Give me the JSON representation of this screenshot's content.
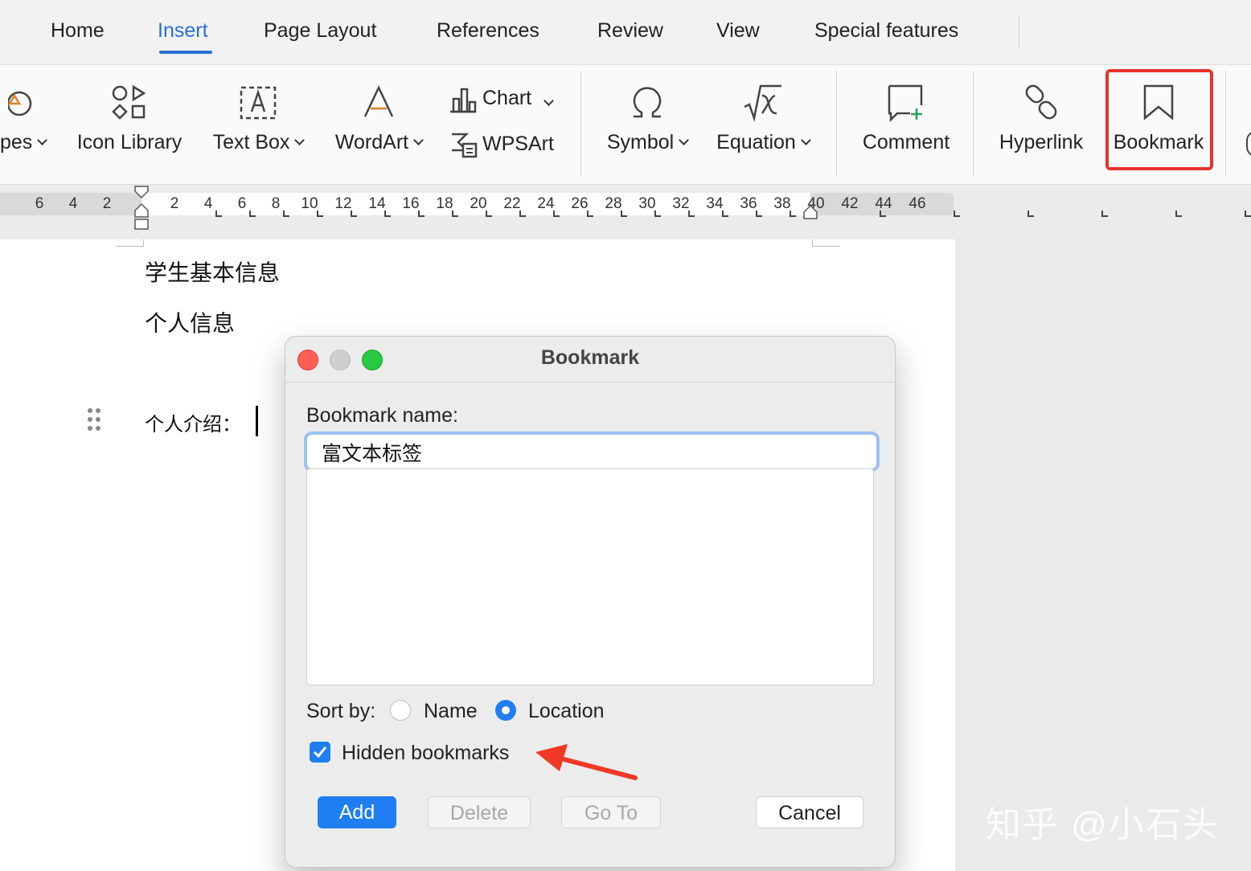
{
  "menu_tabs": [
    {
      "label": "Home"
    },
    {
      "label": "Insert"
    },
    {
      "label": "Page Layout"
    },
    {
      "label": "References"
    },
    {
      "label": "Review"
    },
    {
      "label": "View"
    },
    {
      "label": "Special features"
    }
  ],
  "active_tab": "Insert",
  "ribbon": {
    "shapes": "pes",
    "icon_library": "Icon Library",
    "text_box": "Text Box",
    "wordart": "WordArt",
    "chart": "Chart",
    "wpsart": "WPSArt",
    "symbol": "Symbol",
    "equation": "Equation",
    "comment": "Comment",
    "hyperlink": "Hyperlink",
    "bookmark": "Bookmark"
  },
  "ruler": {
    "numbers": [
      "6",
      "4",
      "2",
      "2",
      "4",
      "6",
      "8",
      "10",
      "12",
      "14",
      "16",
      "18",
      "20",
      "22",
      "24",
      "26",
      "28",
      "30",
      "32",
      "34",
      "36",
      "38",
      "40",
      "42",
      "44",
      "46"
    ]
  },
  "document": {
    "line1": "学生基本信息",
    "line2": "个人信息",
    "line3": "个人介绍："
  },
  "dialog": {
    "title": "Bookmark",
    "name_label": "Bookmark name:",
    "name_value": "富文本标签",
    "sort_label": "Sort by:",
    "sort_name": "Name",
    "sort_location": "Location",
    "sort_selected": "Location",
    "hidden_label": "Hidden bookmarks",
    "hidden_checked": true,
    "add": "Add",
    "delete": "Delete",
    "goto": "Go To",
    "cancel": "Cancel"
  },
  "watermark": "知乎 @小石头",
  "colors": {
    "accent": "#2b6fd6",
    "primary_button": "#1e7ef2",
    "highlight": "#e8322a",
    "traffic_red": "#ff5f57",
    "traffic_green": "#28c840"
  }
}
